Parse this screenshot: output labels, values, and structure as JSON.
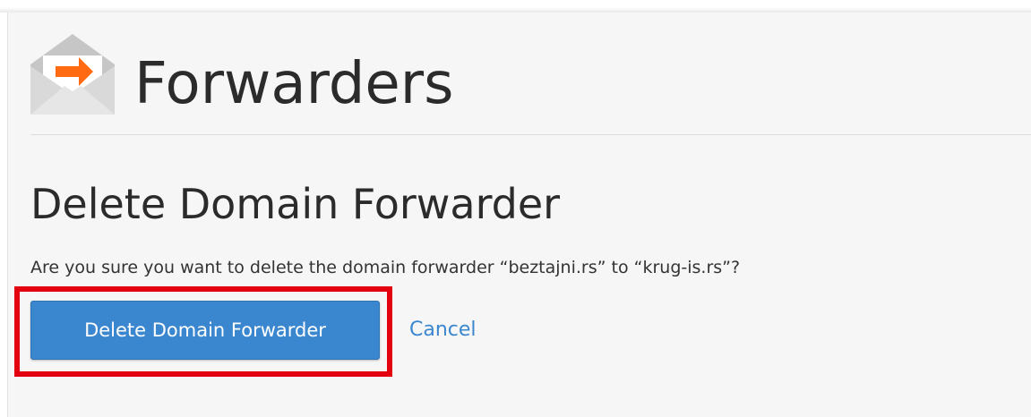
{
  "header": {
    "icon": "email-forward-envelope-icon",
    "title": "Forwarders"
  },
  "section": {
    "heading": "Delete Domain Forwarder",
    "confirm_message": "Are you sure you want to delete the domain forwarder “beztajni.rs” to “krug-is.rs”?"
  },
  "actions": {
    "delete_label": "Delete Domain Forwarder",
    "cancel_label": "Cancel"
  },
  "colors": {
    "primary_button": "#3b87cf",
    "link": "#3b87cf",
    "highlight": "#e3000f",
    "icon_arrow": "#ff6a12",
    "icon_envelope": "#c9c9c9"
  }
}
